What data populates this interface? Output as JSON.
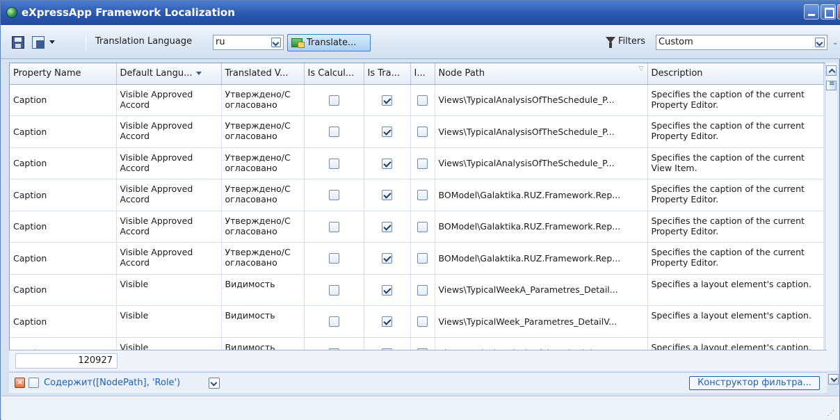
{
  "window": {
    "title": "eXpressApp Framework Localization"
  },
  "toolbar": {
    "translation_language_label": "Translation Language",
    "translation_language_value": "ru",
    "translate_button": "Translate...",
    "filters_label": "Filters",
    "filters_value": "Custom"
  },
  "grid": {
    "columns": [
      "Property Name",
      "Default Langu...",
      "Translated V...",
      "Is Calcul...",
      "Is Tra...",
      "I...",
      "Node Path",
      "Description"
    ],
    "rows": [
      {
        "property": "Caption",
        "default": "Visible Approved Accord",
        "translated": "Утверждено/Согласовано",
        "is_calculated": false,
        "is_translated": true,
        "i": false,
        "node_path": "Views\\TypicalAnalysisOfTheSchedule_P...",
        "description": "Specifies the caption of the current Property Editor."
      },
      {
        "property": "Caption",
        "default": "Visible Approved Accord",
        "translated": "Утверждено/Согласовано",
        "is_calculated": false,
        "is_translated": true,
        "i": false,
        "node_path": "Views\\TypicalAnalysisOfTheSchedule_P...",
        "description": "Specifies the caption of the current Property Editor."
      },
      {
        "property": "Caption",
        "default": "Visible Approved Accord",
        "translated": "Утверждено/Согласовано",
        "is_calculated": false,
        "is_translated": true,
        "i": false,
        "node_path": "Views\\TypicalAnalysisOfTheSchedule_P...",
        "description": "Specifies the caption of the current View Item."
      },
      {
        "property": "Caption",
        "default": "Visible Approved Accord",
        "translated": "Утверждено/Согласовано",
        "is_calculated": false,
        "is_translated": true,
        "i": false,
        "node_path": "BOModel\\Galaktika.RUZ.Framework.Rep...",
        "description": "Specifies the caption of the current Property Editor."
      },
      {
        "property": "Caption",
        "default": "Visible Approved Accord",
        "translated": "Утверждено/Согласовано",
        "is_calculated": false,
        "is_translated": true,
        "i": false,
        "node_path": "BOModel\\Galaktika.RUZ.Framework.Rep...",
        "description": "Specifies the caption of the current Property Editor."
      },
      {
        "property": "Caption",
        "default": "Visible Approved Accord",
        "translated": "Утверждено/Согласовано",
        "is_calculated": false,
        "is_translated": true,
        "i": false,
        "node_path": "BOModel\\Galaktika.RUZ.Framework.Rep...",
        "description": "Specifies the caption of the current Property Editor."
      },
      {
        "property": "Caption",
        "default": "Visible",
        "translated": "Видимость",
        "is_calculated": false,
        "is_translated": true,
        "i": false,
        "node_path": "Views\\TypicalWeekA_Parametres_Detail...",
        "description": "Specifies a layout element's caption."
      },
      {
        "property": "Caption",
        "default": "Visible",
        "translated": "Видимость",
        "is_calculated": false,
        "is_translated": true,
        "i": false,
        "node_path": "Views\\TypicalWeek_Parametres_DetailV...",
        "description": "Specifies a layout element's caption."
      },
      {
        "property": "Caption",
        "default": "Visible",
        "translated": "Видимость",
        "is_calculated": false,
        "is_translated": true,
        "i": false,
        "node_path": "Views\\TypicalAnalysisOfTheSchedule_P...",
        "description": "Specifies a layout element's caption."
      }
    ],
    "footer_count": "120927"
  },
  "filter_panel": {
    "expression": "Содержит([NodePath], 'Role')",
    "builder_button": "Конструктор фильтра..."
  }
}
